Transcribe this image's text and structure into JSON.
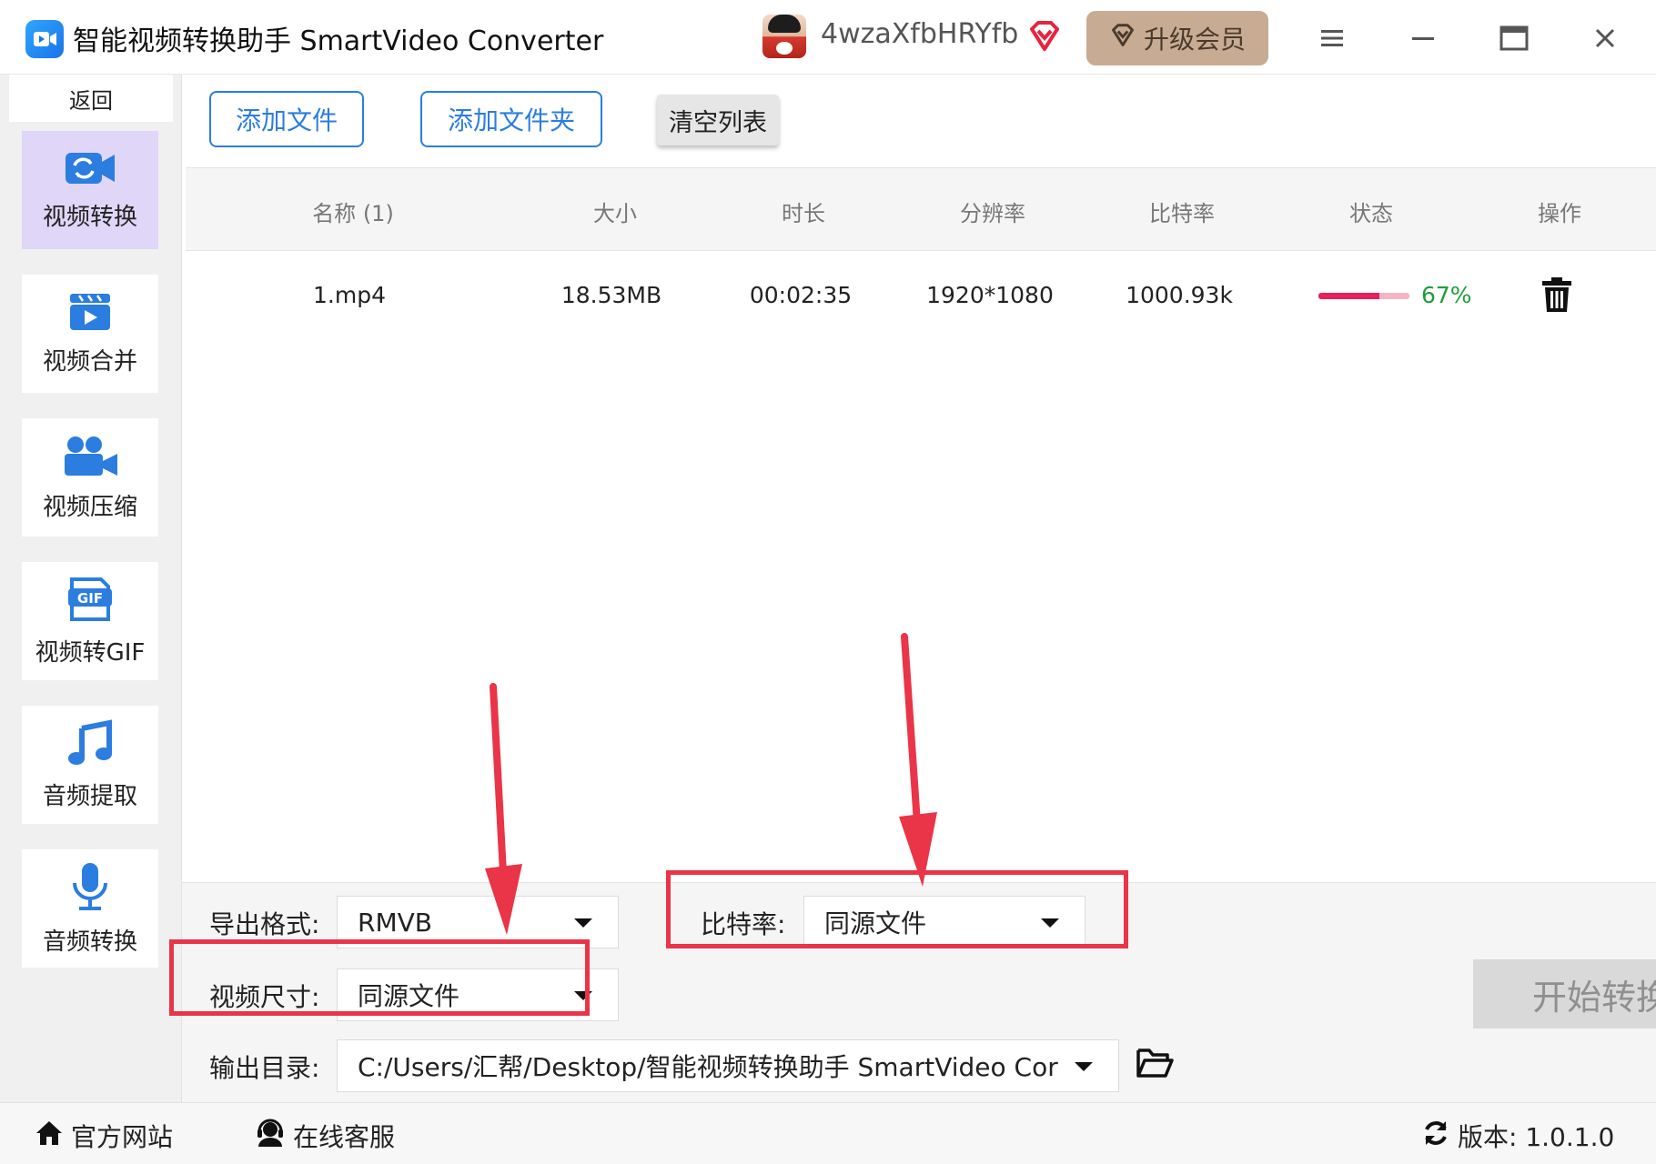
{
  "titlebar": {
    "title": "智能视频转换助手 SmartVideo Converter",
    "username": "4wzaXfbHRYfb",
    "upgrade_label": "升级会员",
    "icons": [
      "app-logo-icon",
      "vip-diamond-icon",
      "menu-icon",
      "minimize-icon",
      "maximize-icon",
      "close-icon"
    ]
  },
  "sidebar": {
    "back_label": "返回",
    "items": [
      {
        "label": "视频转换",
        "icon": "video-convert-icon",
        "active": true
      },
      {
        "label": "视频合并",
        "icon": "video-merge-icon",
        "active": false
      },
      {
        "label": "视频压缩",
        "icon": "video-compress-icon",
        "active": false
      },
      {
        "label": "视频转GIF",
        "icon": "gif-icon",
        "active": false
      },
      {
        "label": "音频提取",
        "icon": "music-note-icon",
        "active": false
      },
      {
        "label": "音频转换",
        "icon": "microphone-icon",
        "active": false
      }
    ]
  },
  "toolbar": {
    "add_file_label": "添加文件",
    "add_folder_label": "添加文件夹",
    "clear_list_label": "清空列表"
  },
  "table": {
    "columns": [
      "名称 (1)",
      "大小",
      "时长",
      "分辨率",
      "比特率",
      "状态",
      "操作"
    ],
    "rows": [
      {
        "name": "1.mp4",
        "size": "18.53MB",
        "duration": "00:02:35",
        "resolution": "1920*1080",
        "bitrate": "1000.93k",
        "progress_percent": 67,
        "status_text": "67%"
      }
    ]
  },
  "settings": {
    "format_label": "导出格式:",
    "format_value": "RMVB",
    "bitrate_label": "比特率:",
    "bitrate_value": "同源文件",
    "size_label": "视频尺寸:",
    "size_value": "同源文件",
    "output_label": "输出目录:",
    "output_value": "C:/Users/汇帮/Desktop/智能视频转换助手 SmartVideo Cor",
    "start_label": "开始转换"
  },
  "footer": {
    "website_label": "官方网站",
    "support_label": "在线客服",
    "version_label": "版本:  1.0.1.0"
  },
  "colors": {
    "accent_blue": "#2b7de0",
    "active_nav": "#e0d6f7",
    "upgrade_bg": "#c8ab93",
    "progress_fill": "#e8205c",
    "progress_text": "#1f9d3a",
    "annotation_red": "#ea3447"
  }
}
